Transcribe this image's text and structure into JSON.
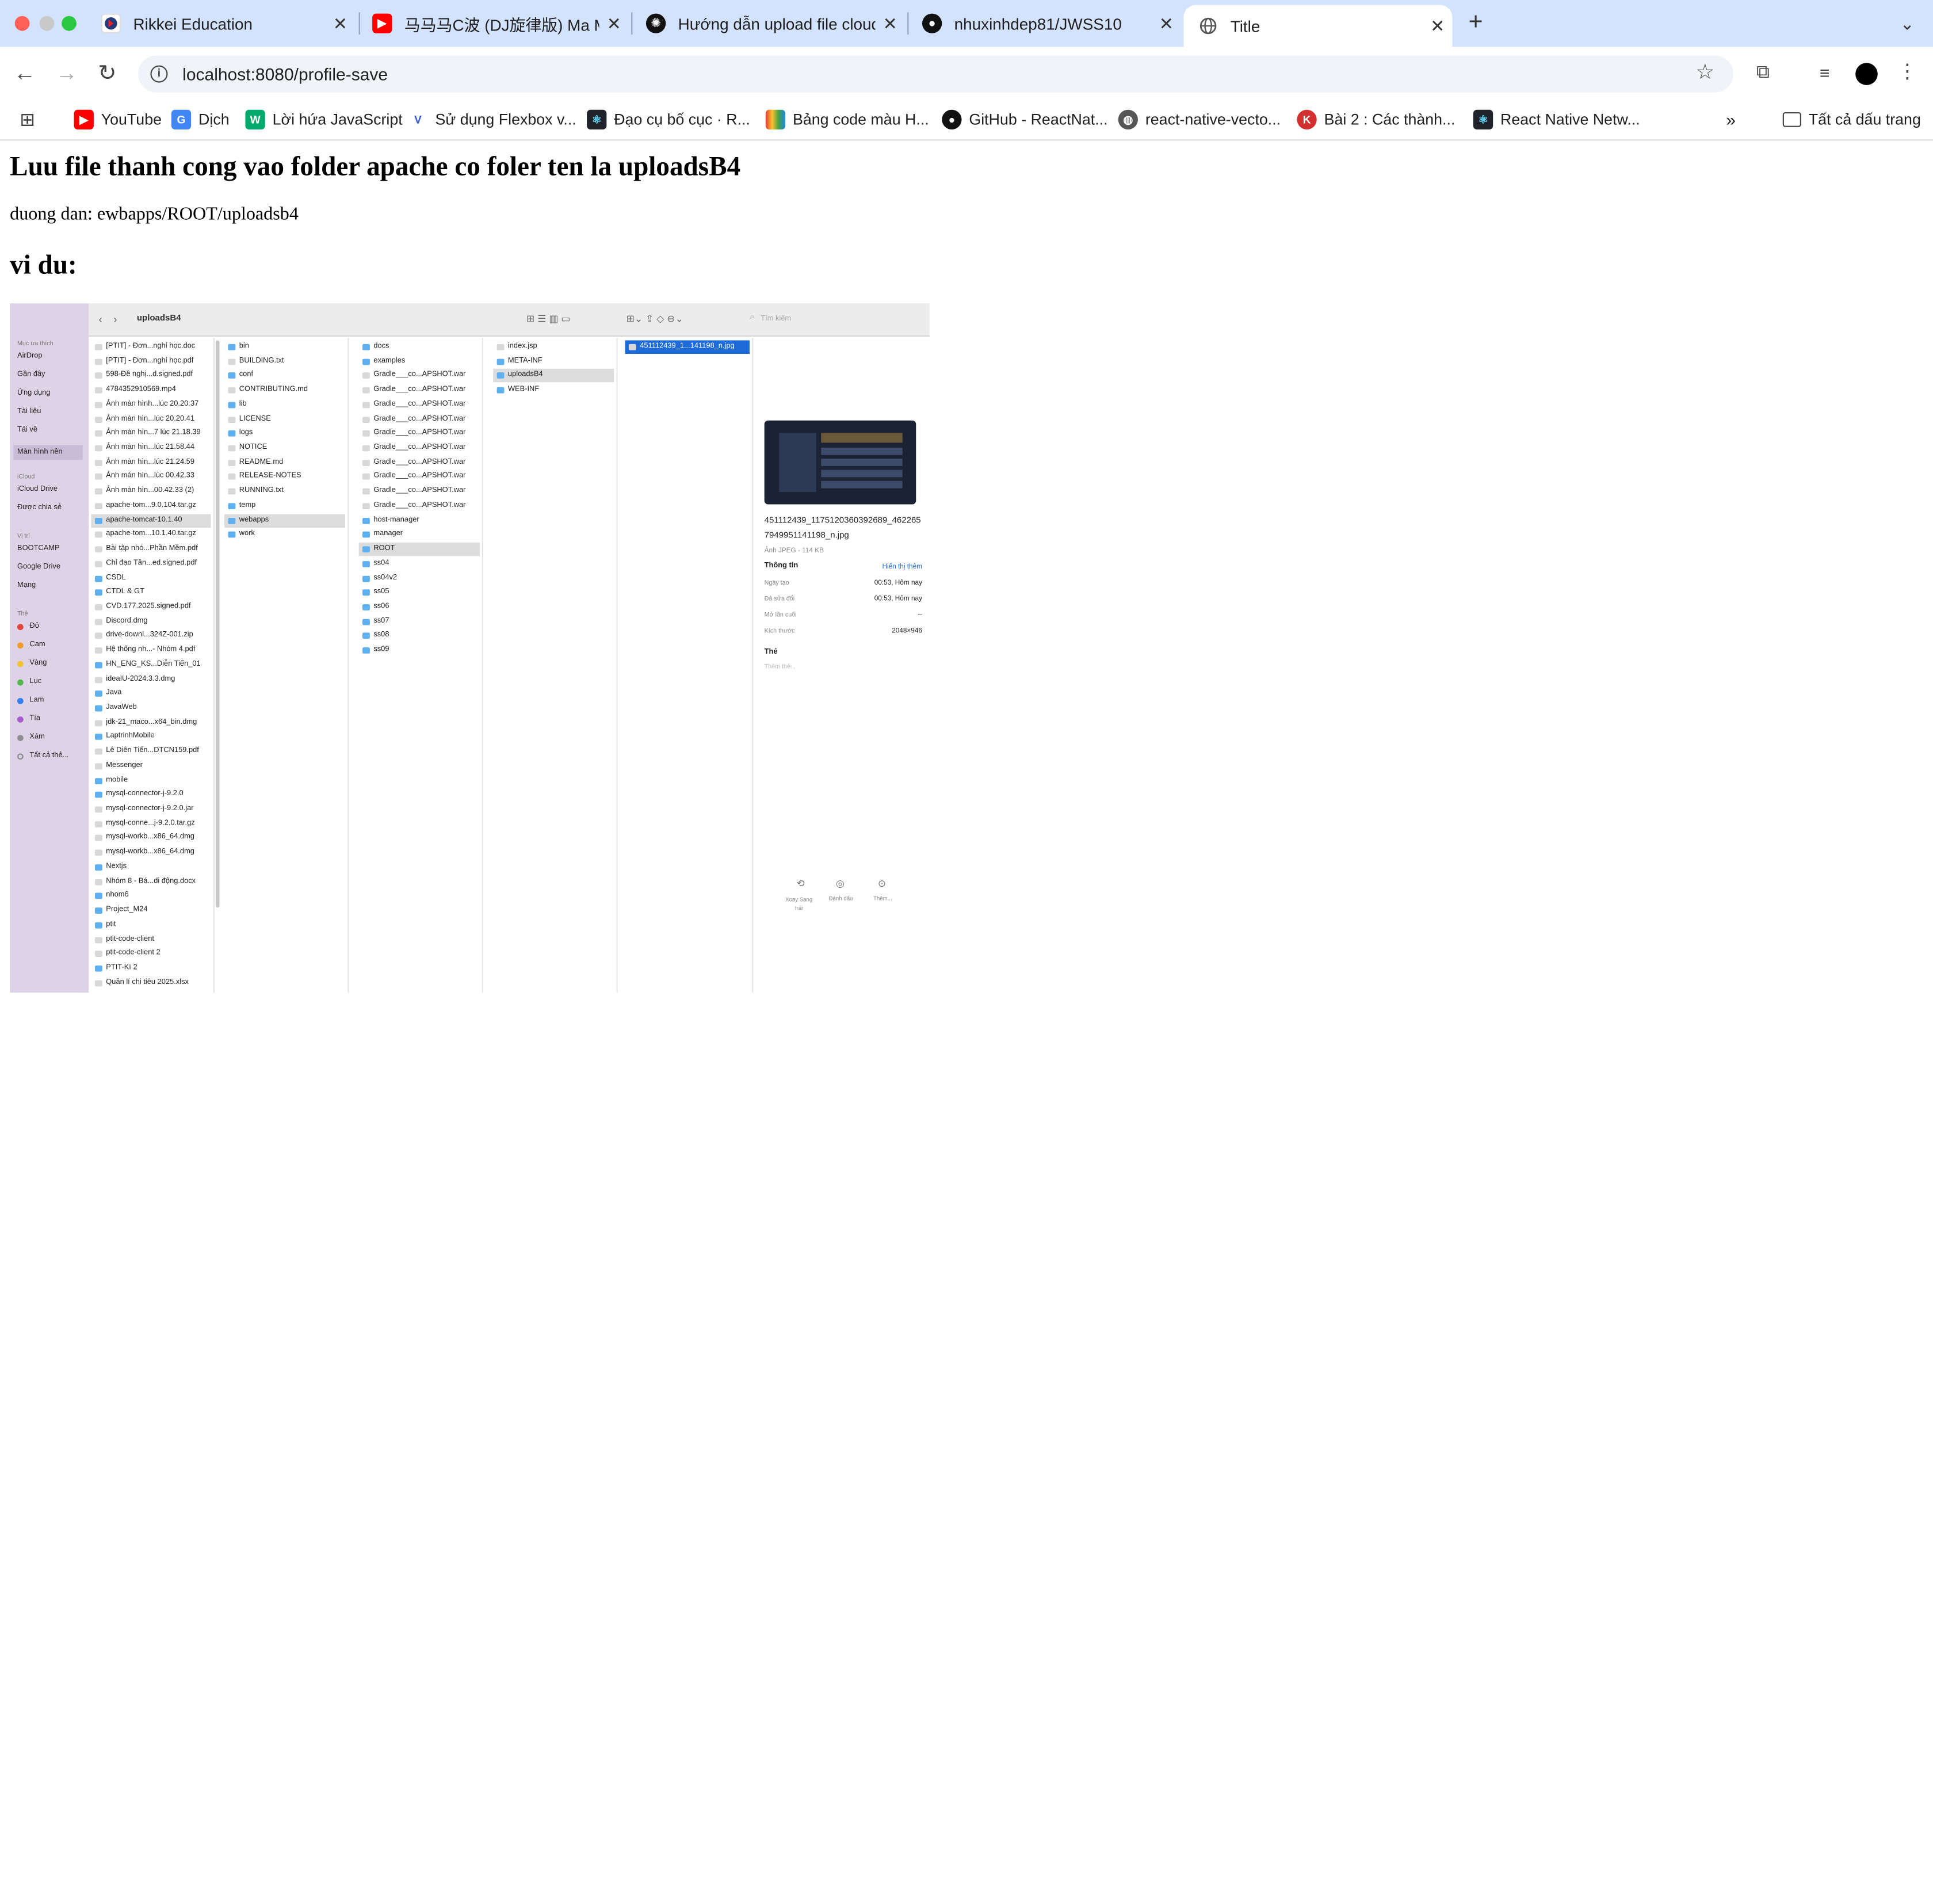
{
  "tabs": [
    {
      "title": "Rikkei Education",
      "icon": "rikkei-icon"
    },
    {
      "title": "马马马C波 (DJ旋律版) Ma Ma",
      "icon": "youtube-icon"
    },
    {
      "title": "Hướng dẫn upload file cloud",
      "icon": "openai-icon"
    },
    {
      "title": "nhuxinhdep81/JWSS10",
      "icon": "github-icon"
    },
    {
      "title": "Title",
      "icon": "globe-icon",
      "active": true
    }
  ],
  "url": "localhost:8080/profile-save",
  "bookmarks": [
    {
      "label": "YouTube"
    },
    {
      "label": "Dịch"
    },
    {
      "label": "Lời hứa JavaScript"
    },
    {
      "label": "Sử dụng Flexbox v..."
    },
    {
      "label": "Đạo cụ bố cục · R..."
    },
    {
      "label": "Bảng code màu H..."
    },
    {
      "label": "GitHub - ReactNat..."
    },
    {
      "label": "react-native-vecto..."
    },
    {
      "label": "Bài 2 : Các thành..."
    },
    {
      "label": "React Native Netw..."
    }
  ],
  "all_bookmarks": "Tất cả dấu trang",
  "page": {
    "heading": "Luu file thanh cong vao folder apache co foler ten la uploadsB4",
    "path": "duong dan: ewbapps/ROOT/uploadsb4",
    "example": "vi du:"
  },
  "finder": {
    "folder": "uploadsB4",
    "search_placeholder": "Tìm kiếm",
    "sidebar": {
      "favorites_header": "Mục ưa thích",
      "favorites": [
        "AirDrop",
        "Gần đây",
        "Ứng dụng",
        "Tài liệu",
        "Tải về",
        "Màn hình nền"
      ],
      "icloud_header": "iCloud",
      "icloud": [
        "iCloud Drive",
        "Được chia sẻ"
      ],
      "locations_header": "Vị trí",
      "locations": [
        "BOOTCAMP",
        "Google Drive",
        "Mạng"
      ],
      "tags_header": "Thẻ",
      "tags": [
        {
          "name": "Đỏ",
          "color": "#e5453a"
        },
        {
          "name": "Cam",
          "color": "#f39a2b"
        },
        {
          "name": "Vàng",
          "color": "#f2c530"
        },
        {
          "name": "Lục",
          "color": "#55b84a"
        },
        {
          "name": "Lam",
          "color": "#2f7ff0"
        },
        {
          "name": "Tía",
          "color": "#a65bd0"
        },
        {
          "name": "Xám",
          "color": "#8e8e93"
        },
        {
          "name": "Tất cả thẻ..."
        }
      ]
    },
    "col1": [
      "[PTIT] - Đơn...nghỉ học.doc",
      "[PTIT] - Đơn...nghỉ học.pdf",
      "598-Đề nghị...d.signed.pdf",
      "4784352910569.mp4",
      "Ảnh màn hình...lúc 20.20.37",
      "Ảnh màn hìn...lúc 20.20.41",
      "Ảnh màn hìn...7 lúc 21.18.39",
      "Ảnh màn hìn...lúc 21.58.44",
      "Ảnh màn hìn...lúc 21.24.59",
      "Ảnh màn hìn...lúc 00.42.33",
      "Ảnh màn hìn...00.42.33 (2)",
      "apache-tom...9.0.104.tar.gz",
      "apache-tomcat-10.1.40",
      "apache-tom...10.1.40.tar.gz",
      "Bài tập nhó...Phần Mềm.pdf",
      "Chỉ đạo Tần...ed.signed.pdf",
      "CSDL",
      "CTDL & GT",
      "CVD.177.2025.signed.pdf",
      "Discord.dmg",
      "drive-downl...324Z-001.zip",
      "Hệ thống nh...- Nhóm 4.pdf",
      "HN_ENG_KS...Diễn Tiến_01",
      "ideaIU-2024.3.3.dmg",
      "Java",
      "JavaWeb",
      "jdk-21_maco...x64_bin.dmg",
      "LaptrinhMobile",
      "Lê Diên Tiến...DTCN159.pdf",
      "Messenger",
      "mobile",
      "mysql-connector-j-9.2.0",
      "mysql-connector-j-9.2.0.jar",
      "mysql-conne...j-9.2.0.tar.gz",
      "mysql-workb...x86_64.dmg",
      "mysql-workb...x86_64.dmg",
      "Nextjs",
      "Nhóm 8 - Bá...di động.docx",
      "nhom6",
      "Project_M24",
      "ptit",
      "ptit-code-client",
      "ptit-code-client 2",
      "PTIT-Kì 2",
      "Quản lí chi tiêu 2025.xlsx"
    ],
    "col2": [
      "bin",
      "BUILDING.txt",
      "conf",
      "CONTRIBUTING.md",
      "lib",
      "LICENSE",
      "logs",
      "NOTICE",
      "README.md",
      "RELEASE-NOTES",
      "RUNNING.txt",
      "temp",
      "webapps",
      "work"
    ],
    "col3": [
      "docs",
      "examples",
      "Gradle___co...APSHOT.war",
      "Gradle___co...APSHOT.war",
      "Gradle___co...APSHOT.war",
      "Gradle___co...APSHOT.war",
      "Gradle___co...APSHOT.war",
      "Gradle___co...APSHOT.war",
      "Gradle___co...APSHOT.war",
      "Gradle___co...APSHOT.war",
      "Gradle___co...APSHOT.war",
      "Gradle___co...APSHOT.war",
      "host-manager",
      "manager",
      "ROOT",
      "ss04",
      "ss04v2",
      "ss05",
      "ss06",
      "ss07",
      "ss08",
      "ss09"
    ],
    "col4": [
      "index.jsp",
      "META-INF",
      "uploadsB4",
      "WEB-INF"
    ],
    "col5": [
      "451112439_1...141198_n.jpg"
    ],
    "preview": {
      "filename": "451112439_1175120360392689_4622657949951141198_n.jpg",
      "kind": "Ảnh JPEG - 114 KB",
      "info_label": "Thông tin",
      "show_more": "Hiển thị thêm",
      "created_label": "Ngày tạo",
      "created": "00:53, Hôm nay",
      "modified_label": "Đã sửa đổi",
      "modified": "00:53, Hôm nay",
      "opened_label": "Mở lần cuối",
      "opened": "--",
      "size_label": "Kích thước",
      "size": "2048×946",
      "tags_label": "Thẻ",
      "tags_placeholder": "Thêm thẻ...",
      "actions": [
        "Xoay Sang trái",
        "Đánh dấu",
        "Thêm..."
      ]
    }
  }
}
